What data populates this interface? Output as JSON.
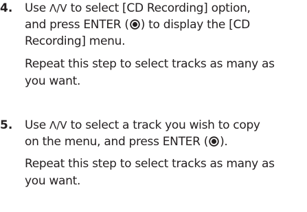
{
  "step4": {
    "number": "4.",
    "line1_a": "Use ",
    "arrows": "Λ/V",
    "line1_b": " to select [CD Recording] option,",
    "line2_a": "and press ENTER (",
    "line2_b": ") to display the [CD",
    "line3": "Recording] menu.",
    "line4": "Repeat this step to select tracks as many as",
    "line5": "you want."
  },
  "step5": {
    "number": "5.",
    "line1_a": "Use ",
    "arrows": "Λ/V",
    "line1_b": " to select a track you wish to copy",
    "line2_a": "on the menu, and press ENTER (",
    "line2_b": ").",
    "line3": "Repeat this step to select tracks as many as",
    "line4": "you want."
  },
  "icons": {
    "enter": "enter-button-icon",
    "color": "#231f20"
  }
}
